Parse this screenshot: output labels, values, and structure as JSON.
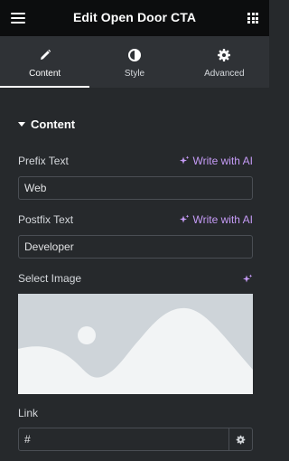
{
  "header": {
    "title": "Edit Open Door CTA",
    "menu_icon": "hamburger-icon",
    "apps_icon": "grid-icon"
  },
  "tabs": [
    {
      "label": "Content",
      "icon": "pencil-icon",
      "active": true
    },
    {
      "label": "Style",
      "icon": "half-circle-icon",
      "active": false
    },
    {
      "label": "Advanced",
      "icon": "gear-icon",
      "active": false
    }
  ],
  "section": {
    "title": "Content",
    "expanded": true
  },
  "fields": {
    "prefix": {
      "label": "Prefix Text",
      "value": "Web",
      "ai_label": "Write with AI"
    },
    "postfix": {
      "label": "Postfix Text",
      "value": "Developer",
      "ai_label": "Write with AI"
    },
    "image": {
      "label": "Select Image",
      "placeholder_icon": "image-placeholder"
    },
    "link": {
      "label": "Link",
      "value": "#",
      "settings_icon": "gear-icon"
    }
  },
  "colors": {
    "background": "#26292c",
    "header": "#0c0d0e",
    "tabs": "#2f3236",
    "ai_accent": "#c59bf6",
    "image_placeholder": "#ced4d9"
  }
}
